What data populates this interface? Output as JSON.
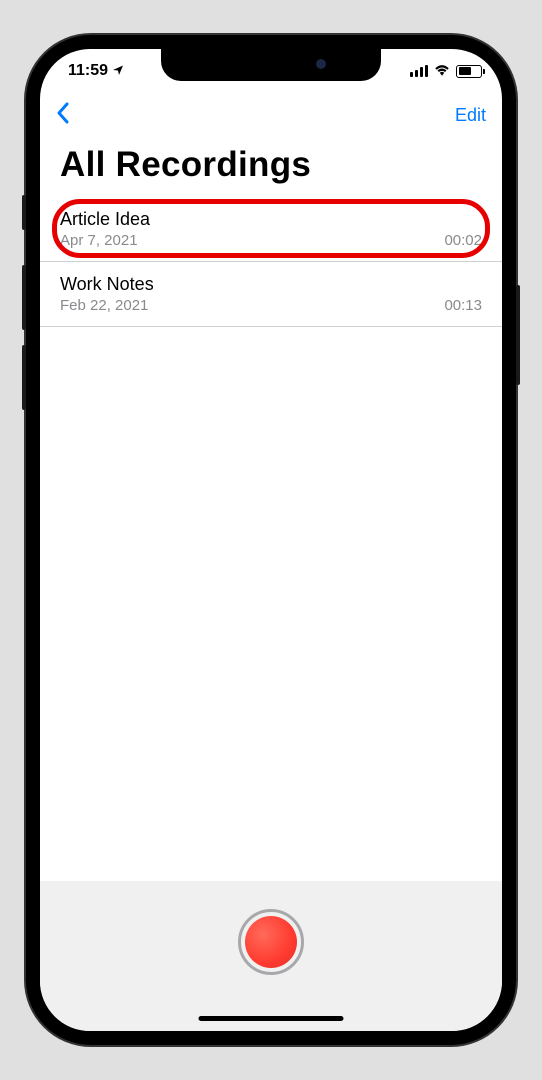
{
  "status": {
    "time": "11:59",
    "location_active": true
  },
  "nav": {
    "edit_label": "Edit"
  },
  "page": {
    "title": "All Recordings"
  },
  "recordings": [
    {
      "title": "Article Idea",
      "date": "Apr 7, 2021",
      "duration": "00:02",
      "highlighted": true
    },
    {
      "title": "Work Notes",
      "date": "Feb 22, 2021",
      "duration": "00:13",
      "highlighted": false
    }
  ]
}
